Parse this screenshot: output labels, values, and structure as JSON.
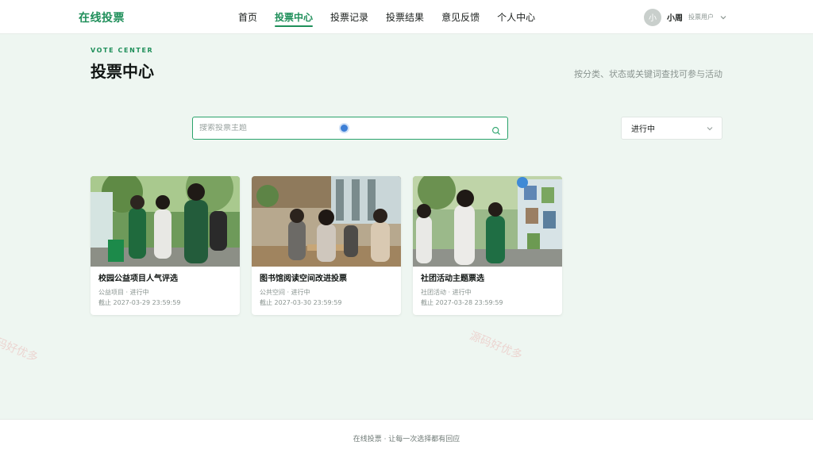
{
  "header": {
    "brand": "在线投票",
    "nav": [
      {
        "label": "首页",
        "active": false
      },
      {
        "label": "投票中心",
        "active": true
      },
      {
        "label": "投票记录",
        "active": false
      },
      {
        "label": "投票结果",
        "active": false
      },
      {
        "label": "意见反馈",
        "active": false
      },
      {
        "label": "个人中心",
        "active": false
      }
    ],
    "user": {
      "avatar_text": "小",
      "name": "小周",
      "role": "投票用户"
    }
  },
  "hero": {
    "eyebrow": "VOTE CENTER",
    "title": "投票中心",
    "description": "按分类、状态或关键词查找可参与活动"
  },
  "filters": {
    "search_placeholder": "搜索投票主题",
    "search_value": "",
    "status_selected": "进行中"
  },
  "cards": [
    {
      "title": "校园公益项目人气评选",
      "meta": "公益项目 · 进行中",
      "deadline": "截止 2027-03-29 23:59:59"
    },
    {
      "title": "图书馆阅读空间改进投票",
      "meta": "公共空间 · 进行中",
      "deadline": "截止 2027-03-30 23:59:59"
    },
    {
      "title": "社团活动主题票选",
      "meta": "社团活动 · 进行中",
      "deadline": "截止 2027-03-28 23:59:59"
    }
  ],
  "footer": {
    "text": "在线投票 · 让每一次选择都有回应"
  },
  "watermark": "源码好优多",
  "colors": {
    "accent": "#1f8f5a",
    "background": "#eef6f1"
  }
}
